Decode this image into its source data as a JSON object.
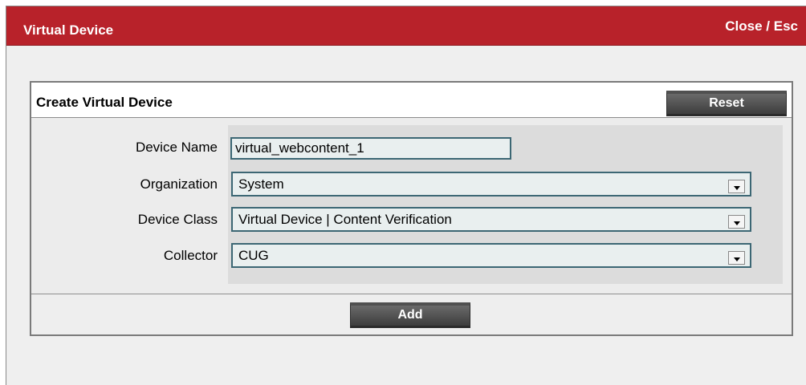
{
  "window": {
    "title": "Virtual Device",
    "close_label": "Close / Esc"
  },
  "panel": {
    "title": "Create Virtual Device",
    "reset_label": "Reset",
    "add_label": "Add"
  },
  "form": {
    "device_name": {
      "label": "Device Name",
      "value": "virtual_webcontent_1"
    },
    "organization": {
      "label": "Organization",
      "value": "System"
    },
    "device_class": {
      "label": "Device Class",
      "value": "Virtual Device | Content Verification"
    },
    "collector": {
      "label": "Collector",
      "value": "CUG"
    }
  },
  "icons": {
    "dropdown": "chevron-down-icon"
  },
  "colors": {
    "titlebar": "#b8222a",
    "button": "#4a4a4a",
    "field_border": "#3c6774"
  }
}
